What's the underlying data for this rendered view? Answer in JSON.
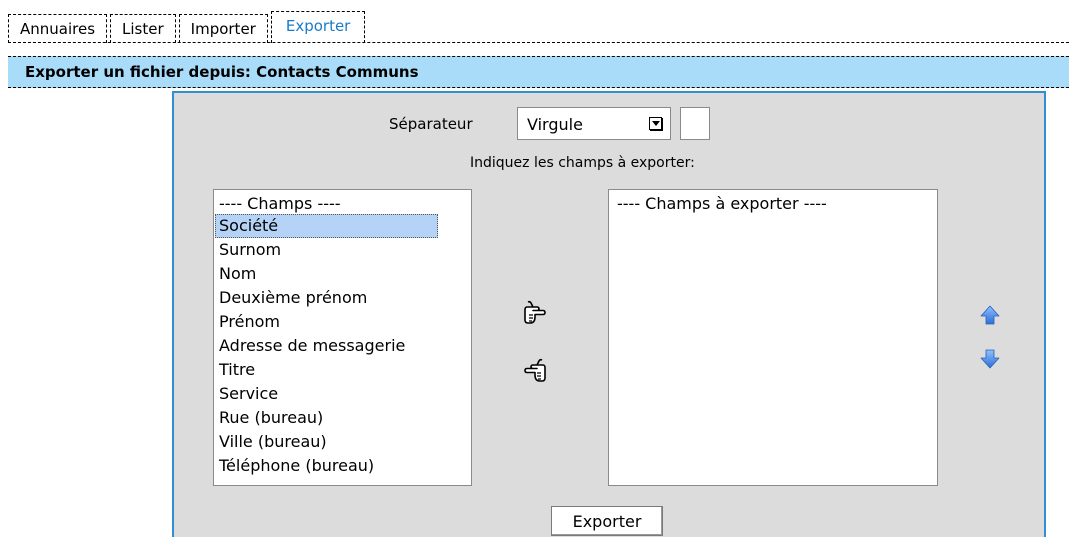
{
  "tabs": [
    {
      "label": "Annuaires"
    },
    {
      "label": "Lister"
    },
    {
      "label": "Importer"
    },
    {
      "label": "Exporter"
    }
  ],
  "header": {
    "title": "Exporter un fichier depuis: Contacts Communs"
  },
  "separator": {
    "label": "Séparateur",
    "selected": "Virgule",
    "custom_value": ""
  },
  "instructions": "Indiquez les champs à exporter:",
  "fields_list": {
    "header": "---- Champs ----",
    "items": [
      {
        "label": "Société"
      },
      {
        "label": "Surnom"
      },
      {
        "label": "Nom"
      },
      {
        "label": "Deuxième prénom"
      },
      {
        "label": "Prénom"
      },
      {
        "label": "Adresse de messagerie"
      },
      {
        "label": "Titre"
      },
      {
        "label": "Service"
      },
      {
        "label": "Rue (bureau)"
      },
      {
        "label": "Ville (bureau)"
      },
      {
        "label": "Téléphone (bureau)"
      }
    ],
    "selected": "Société"
  },
  "export_list": {
    "header": "---- Champs à exporter ----"
  },
  "buttons": {
    "export_label": "Exporter"
  },
  "icons": {
    "add": "hand-pointing-right-icon",
    "remove": "hand-pointing-left-icon",
    "move_up": "arrow-up-icon",
    "move_down": "arrow-down-icon"
  },
  "colors": {
    "header_bg": "#a8dcf9",
    "panel_border": "#2f8fd0",
    "panel_bg": "#dcdcdc",
    "active_tab_text": "#1a7cc8",
    "arrow_blue": "#3a7ee0",
    "selection": "#b4d3f7"
  }
}
